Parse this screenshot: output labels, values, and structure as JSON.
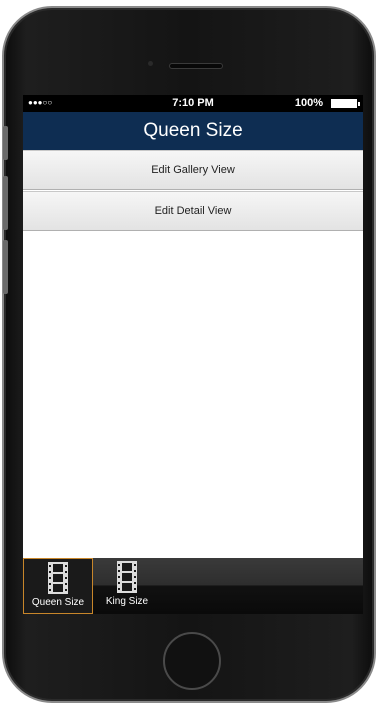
{
  "status_bar": {
    "signal": "●●●○○",
    "time": "7:10 PM",
    "battery": "100%"
  },
  "nav": {
    "title": "Queen Size"
  },
  "actions": [
    {
      "label": "Edit Gallery View"
    },
    {
      "label": "Edit Detail View"
    }
  ],
  "tabs": [
    {
      "label": "Queen Size",
      "icon": "film-strip-icon",
      "selected": true
    },
    {
      "label": "King Size",
      "icon": "film-strip-icon",
      "selected": false
    }
  ],
  "colors": {
    "nav_background": "#0e2d52",
    "tab_selected_border": "#c8862a"
  }
}
